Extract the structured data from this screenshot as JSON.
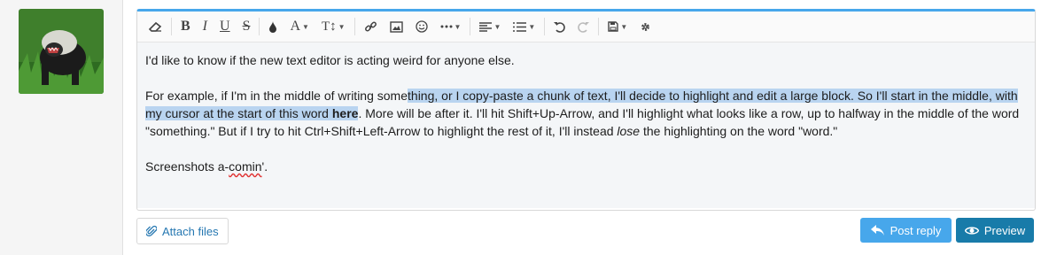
{
  "editor": {
    "toolbar": {
      "text_color_label": "A",
      "font_size_label": "T↕",
      "bold": "B",
      "italic": "I",
      "underline": "U",
      "strike": "S"
    },
    "paragraph1": "I'd like to know if the new text editor is acting weird for anyone else.",
    "p2_before": "For example, if I'm in the middle of writing some",
    "p2_highlight": "thing, or I copy-paste a chunk of text, I'll decide to highlight and edit a large block. So I'll start in the middle, with my cursor at the start of this word ",
    "p2_bold": "here",
    "p2_mid": ". More will be after it. I'll hit Shift+Up-Arrow, and I'll highlight what looks like a row, up to halfway in the middle of the word \"something.\" But if I try to hit Ctrl+Shift+Left-Arrow to highlight the rest of it, I'll instead ",
    "p2_italic": "lose",
    "p2_end": " the highlighting on the word \"word.\"",
    "p3_before": "Screenshots a-",
    "p3_misspelled": "comin",
    "p3_after": "'."
  },
  "actions": {
    "attach_label": "Attach files",
    "post_reply_label": "Post reply",
    "preview_label": "Preview"
  },
  "colors": {
    "accent": "#47a7eb",
    "preview_button": "#187ba9",
    "link": "#2577b1",
    "selection": "#b9d4f0"
  }
}
